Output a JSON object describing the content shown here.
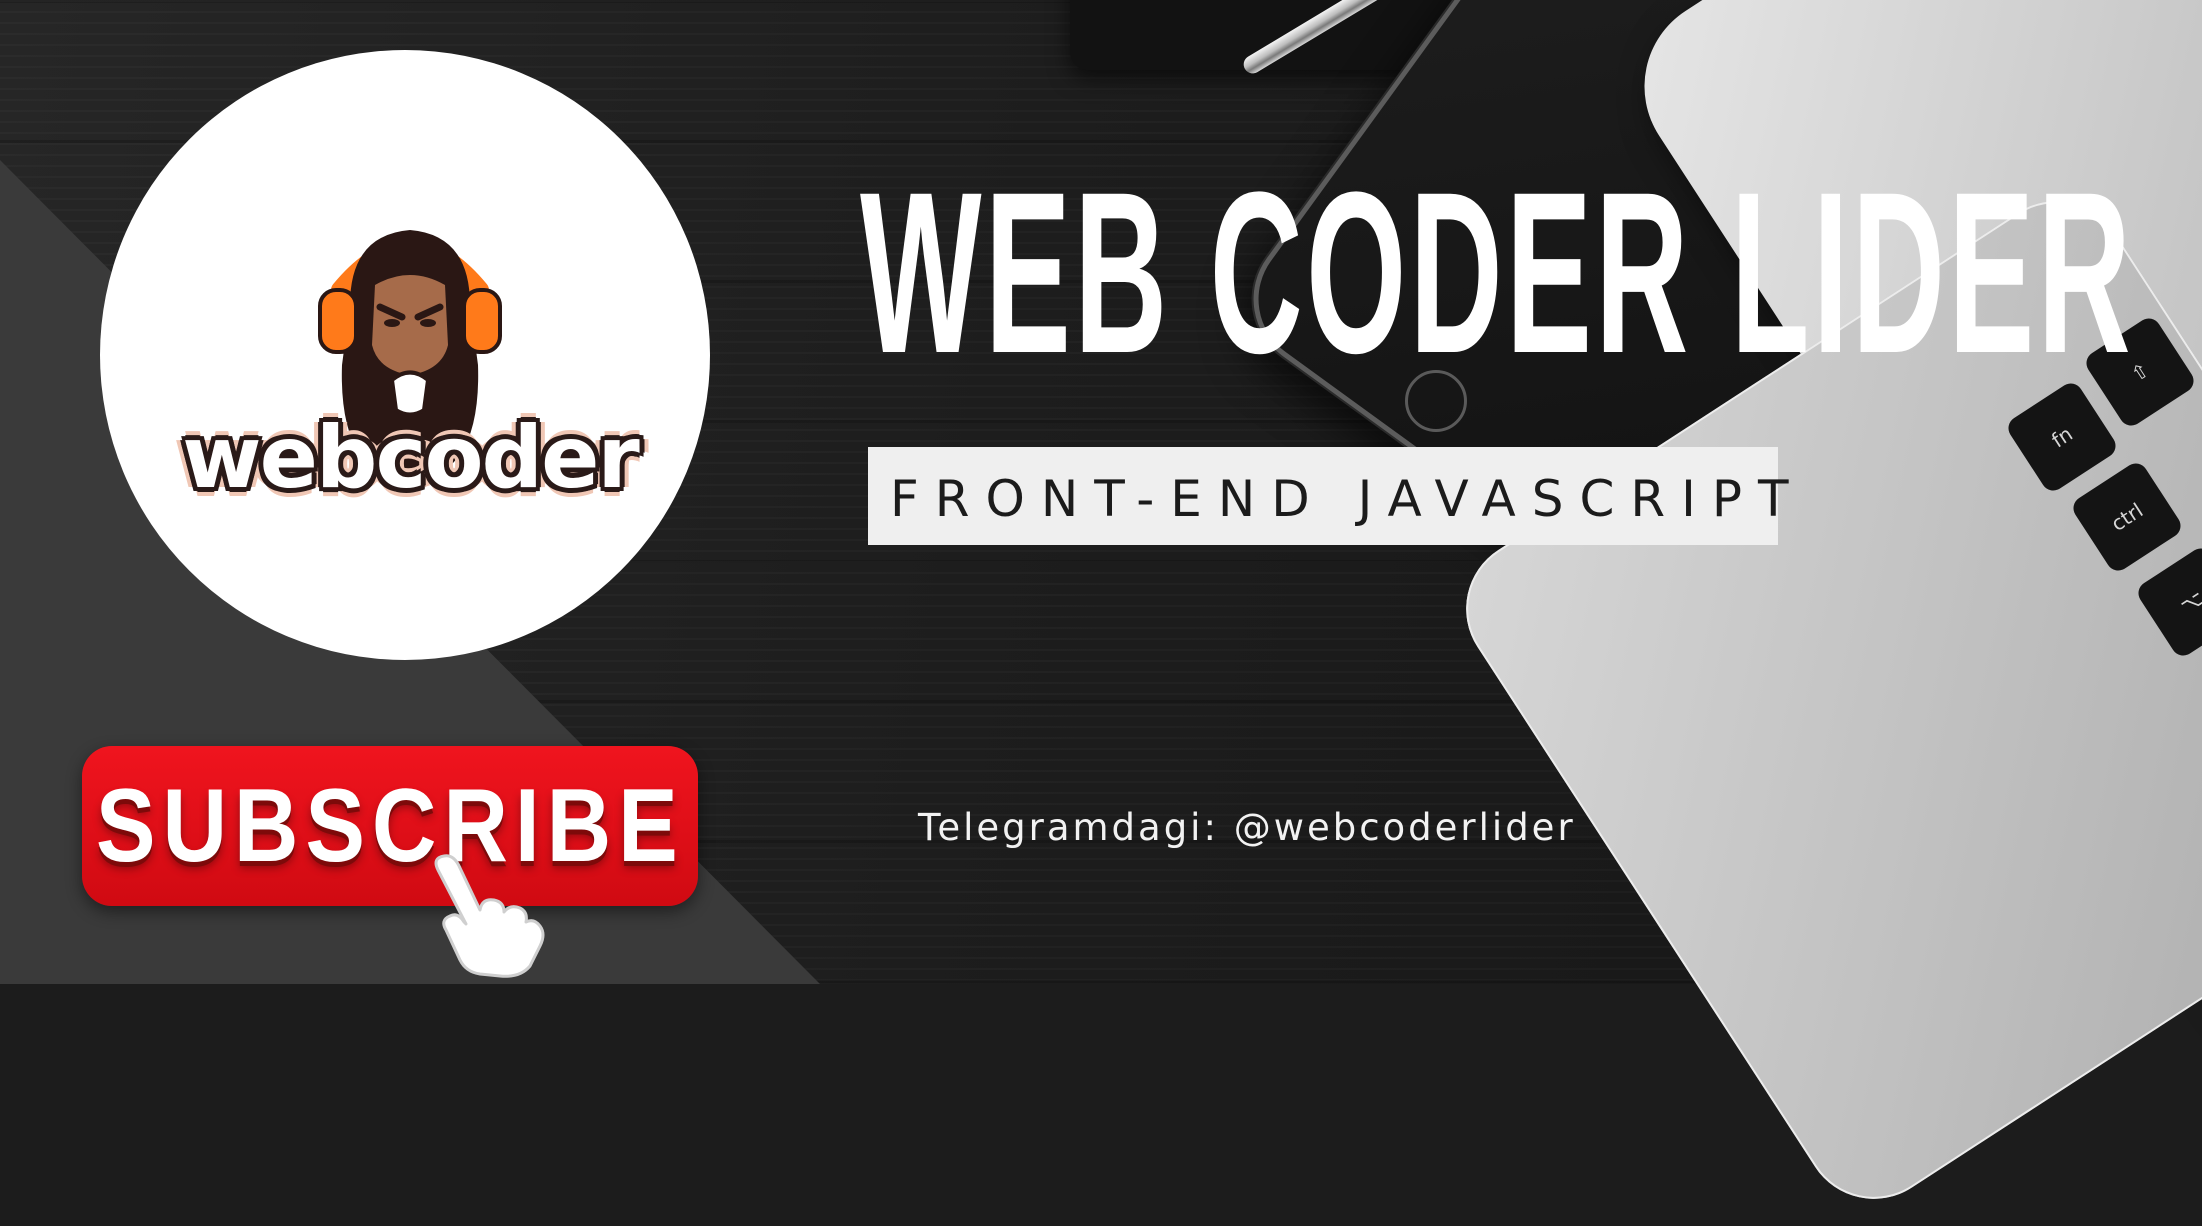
{
  "banner": {
    "title": "WEB CODER LIDER",
    "tagline": "FRONT-END JAVASCRIPT",
    "telegram": "Telegramdagi: @webcoderlider"
  },
  "logo": {
    "wordmark": "webcoder",
    "icon": "bearded-man-headphones-icon"
  },
  "subscribe": {
    "label": "SUBSCRIBE",
    "icon": "pointing-hand-icon"
  },
  "keyboard": {
    "keys": [
      "fn",
      "ctrl",
      "⇧",
      "⌥"
    ]
  },
  "colors": {
    "subscribe_red": "#e50914",
    "logo_orange": "#ff7a1a",
    "background_dark": "#1e1e1e",
    "panel_gray": "#3a3a3a"
  }
}
